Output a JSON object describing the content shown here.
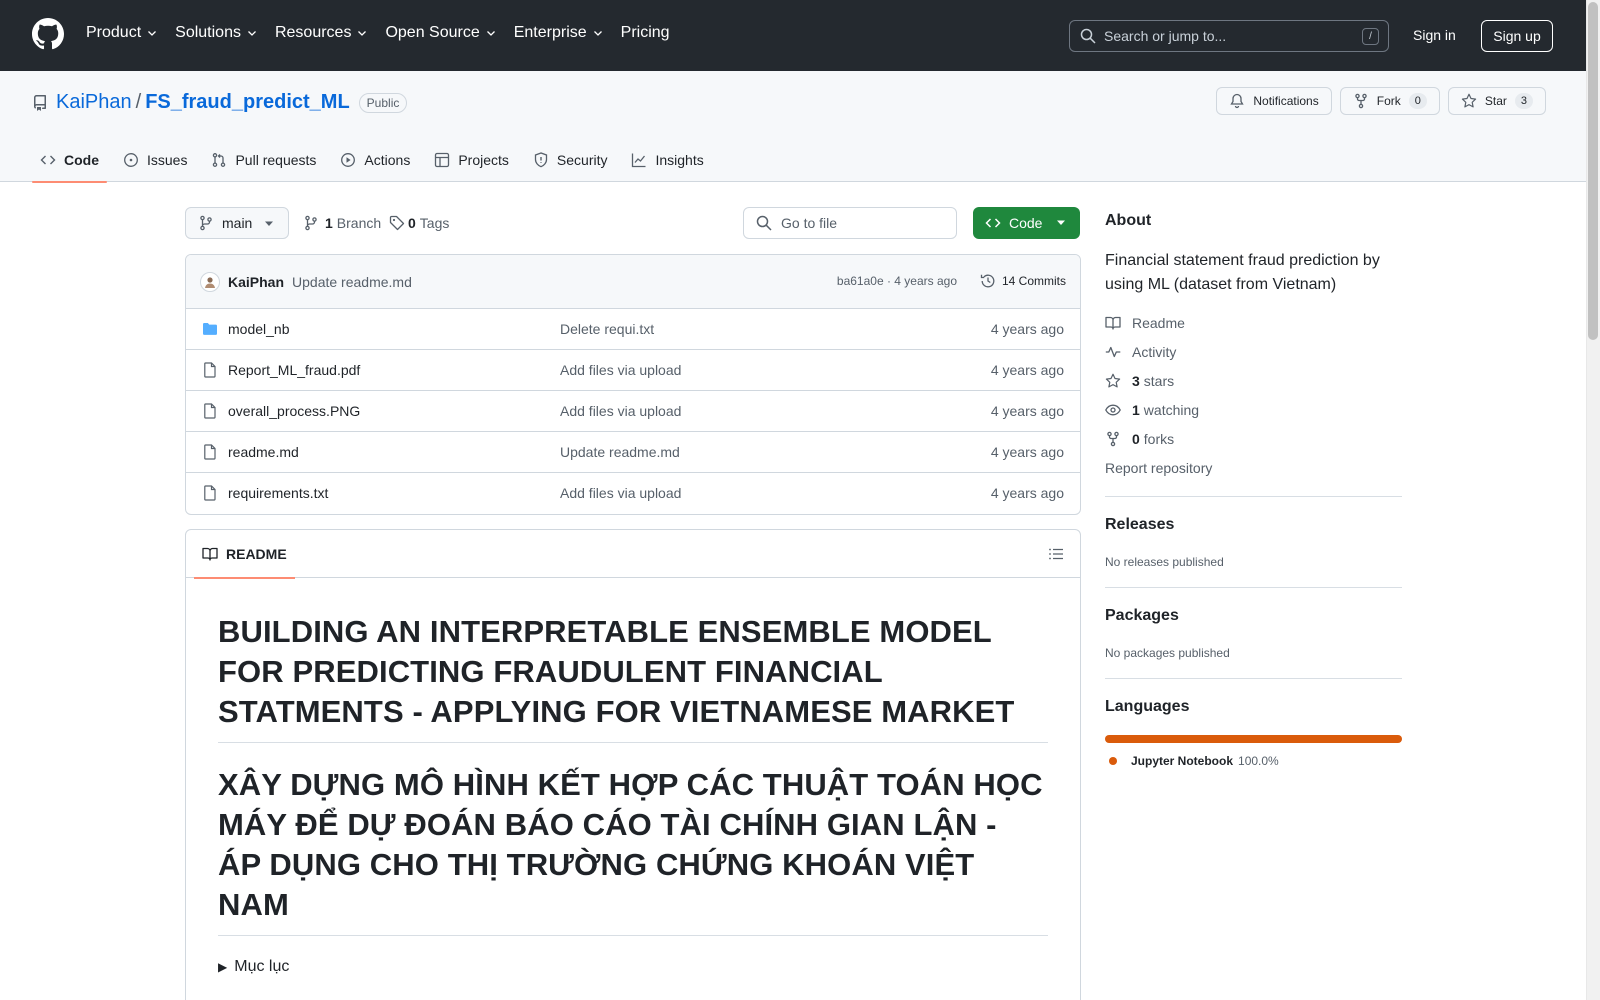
{
  "header": {
    "nav": [
      "Product",
      "Solutions",
      "Resources",
      "Open Source",
      "Enterprise",
      "Pricing"
    ],
    "search_placeholder": "Search or jump to...",
    "search_shortcut": "/",
    "signin": "Sign in",
    "signup": "Sign up"
  },
  "repo": {
    "owner": "KaiPhan",
    "separator": "/",
    "name": "FS_fraud_predict_ML",
    "visibility": "Public",
    "notifications_label": "Notifications",
    "fork_label": "Fork",
    "fork_count": "0",
    "star_label": "Star",
    "star_count": "3"
  },
  "tabs": [
    "Code",
    "Issues",
    "Pull requests",
    "Actions",
    "Projects",
    "Security",
    "Insights"
  ],
  "toolbar": {
    "branch": "main",
    "branch_count": "1",
    "branch_label": "Branch",
    "tag_count": "0",
    "tag_label": "Tags",
    "goto_placeholder": "Go to file",
    "code_label": "Code"
  },
  "commit": {
    "author": "KaiPhan",
    "message": "Update readme.md",
    "meta": "ba61a0e · 4 years ago",
    "count": "14 Commits"
  },
  "files": [
    {
      "name": "model_nb",
      "type": "folder",
      "message": "Delete requi.txt",
      "age": "4 years ago"
    },
    {
      "name": "Report_ML_fraud.pdf",
      "type": "file",
      "message": "Add files via upload",
      "age": "4 years ago"
    },
    {
      "name": "overall_process.PNG",
      "type": "file",
      "message": "Add files via upload",
      "age": "4 years ago"
    },
    {
      "name": "readme.md",
      "type": "file",
      "message": "Update readme.md",
      "age": "4 years ago"
    },
    {
      "name": "requirements.txt",
      "type": "file",
      "message": "Add files via upload",
      "age": "4 years ago"
    }
  ],
  "readme": {
    "tab_label": "README",
    "heading_en": "BUILDING AN INTERPRETABLE ENSEMBLE MODEL FOR PREDICTING FRAUDULENT FINANCIAL STATMENTS - APPLYING FOR VIETNAMESE MARKET",
    "heading_vi": "XÂY DỰNG MÔ HÌNH KẾT HỢP CÁC THUẬT TOÁN HỌC MÁY ĐỂ DỰ ĐOÁN BÁO CÁO TÀI CHÍNH GIAN LẬN - ÁP DỤNG CHO THỊ TRƯỜNG CHỨNG KHOÁN VIỆT NAM",
    "details_summary": "Mục lục"
  },
  "about": {
    "title": "About",
    "description": "Financial statement fraud prediction by using ML (dataset from Vietnam)",
    "readme": "Readme",
    "activity": "Activity",
    "stars_count": "3",
    "stars_label": "stars",
    "watching_count": "1",
    "watching_label": "watching",
    "forks_count": "0",
    "forks_label": "forks",
    "report": "Report repository"
  },
  "releases": {
    "title": "Releases",
    "text": "No releases published"
  },
  "packages": {
    "title": "Packages",
    "text": "No packages published"
  },
  "languages": {
    "title": "Languages",
    "items": [
      {
        "name": "Jupyter Notebook",
        "percent": "100.0%",
        "color": "#DA5B0B"
      }
    ]
  },
  "colors": {
    "header_bg": "#24292f",
    "link": "#0969da",
    "primary_button": "#1f883d",
    "tab_underline": "#fd8c73"
  }
}
